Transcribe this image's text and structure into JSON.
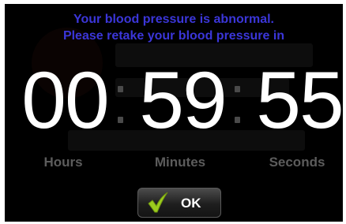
{
  "alert": {
    "line1": "Your blood pressure is abnormal.",
    "line2": "Please retake your blood pressure in"
  },
  "timer": {
    "hours": "00",
    "minutes": "59",
    "seconds": "55",
    "hours_label": "Hours",
    "minutes_label": "Minutes",
    "seconds_label": "Seconds"
  },
  "ok_button": {
    "label": "OK",
    "icon": "checkmark-icon"
  },
  "colors": {
    "background": "#000000",
    "message": "#3b36d9",
    "digits": "#ffffff",
    "unit_labels": "#5c5c5c",
    "checkmark": "#9ccc1e"
  }
}
